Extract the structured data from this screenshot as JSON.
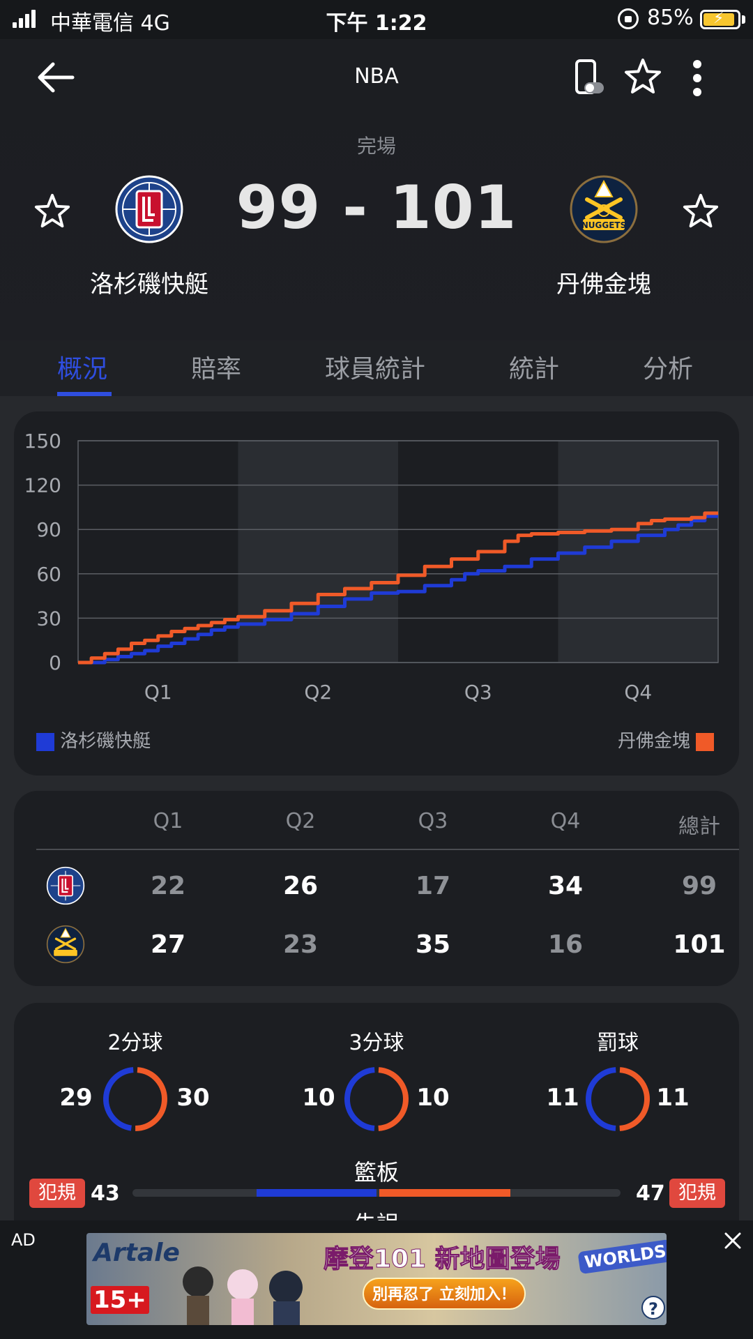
{
  "status_bar": {
    "carrier": "中華電信   4G",
    "time": "下午 1:22",
    "battery": "85%",
    "battery_level": 0.85
  },
  "header": {
    "title": "NBA",
    "game_status": "完場",
    "score": "99 - 101",
    "home": {
      "name": "洛杉磯快艇",
      "logo": "clippers-logo"
    },
    "away": {
      "name": "丹佛金塊",
      "logo": "nuggets-logo"
    }
  },
  "tabs": [
    {
      "label": "概況",
      "active": true
    },
    {
      "label": "賠率",
      "active": false
    },
    {
      "label": "球員統計",
      "active": false
    },
    {
      "label": "統計",
      "active": false
    },
    {
      "label": "分析",
      "active": false
    }
  ],
  "chart_data": {
    "type": "line",
    "x_categories": [
      "Q1",
      "Q2",
      "Q3",
      "Q4"
    ],
    "y_ticks": [
      0,
      30,
      60,
      90,
      120,
      150
    ],
    "ylim": [
      0,
      150
    ],
    "x_range": [
      0,
      48
    ],
    "xlabel": "",
    "ylabel": "",
    "grid": true,
    "legend_placement": "bottom",
    "series": [
      {
        "name": "洛杉磯快艇",
        "color": "#1f3bd6",
        "x": [
          0,
          2,
          3,
          4,
          5,
          6,
          7,
          8,
          9,
          10,
          11,
          12,
          14,
          16,
          18,
          20,
          22,
          24,
          26,
          28,
          29,
          30,
          32,
          34,
          36,
          38,
          40,
          42,
          44,
          45,
          46,
          47,
          48
        ],
        "y": [
          0,
          2,
          4,
          6,
          8,
          11,
          13,
          16,
          19,
          22,
          24,
          26,
          29,
          33,
          38,
          43,
          47,
          48,
          52,
          56,
          60,
          62,
          65,
          70,
          74,
          78,
          82,
          86,
          90,
          93,
          96,
          99,
          99
        ]
      },
      {
        "name": "丹佛金塊",
        "color": "#f05a28",
        "x": [
          0,
          1,
          2,
          3,
          4,
          5,
          6,
          7,
          8,
          9,
          10,
          11,
          12,
          14,
          16,
          18,
          20,
          22,
          24,
          26,
          28,
          30,
          32,
          33,
          34,
          36,
          38,
          40,
          42,
          43,
          44,
          45,
          46,
          47,
          48
        ],
        "y": [
          0,
          3,
          6,
          9,
          13,
          15,
          18,
          21,
          23,
          25,
          27,
          29,
          31,
          35,
          40,
          46,
          50,
          54,
          59,
          65,
          70,
          75,
          82,
          86,
          87,
          88,
          89,
          90,
          94,
          96,
          97,
          97,
          98,
          101,
          101
        ]
      }
    ]
  },
  "quarter_table": {
    "headers": [
      "Q1",
      "Q2",
      "Q3",
      "Q4",
      "總計"
    ],
    "rows": [
      {
        "team_logo": "clippers-logo",
        "scores": [
          "22",
          "26",
          "17",
          "34",
          "99"
        ]
      },
      {
        "team_logo": "nuggets-logo",
        "scores": [
          "27",
          "23",
          "35",
          "16",
          "101"
        ]
      }
    ]
  },
  "shooting": [
    {
      "label": "2分球",
      "home": "29",
      "away": "30",
      "home_share": 0.49
    },
    {
      "label": "3分球",
      "home": "10",
      "away": "10",
      "home_share": 0.5
    },
    {
      "label": "罰球",
      "home": "11",
      "away": "11",
      "home_share": 0.5
    }
  ],
  "rebounds": {
    "label": "籃板"
  },
  "fouls": {
    "label": "犯規",
    "home": "43",
    "away": "47",
    "home_share": 0.478
  },
  "next_label": "失誤",
  "ad": {
    "tag": "AD",
    "brand": "Artale",
    "headline": "摩登101 新地圖登場",
    "cta": "別再忍了 立刻加入！",
    "rating": "15+",
    "badge": "WORLDS"
  },
  "colors": {
    "home": "#1f3bd6",
    "away": "#f05a28",
    "accent": "#2f4ee0"
  }
}
